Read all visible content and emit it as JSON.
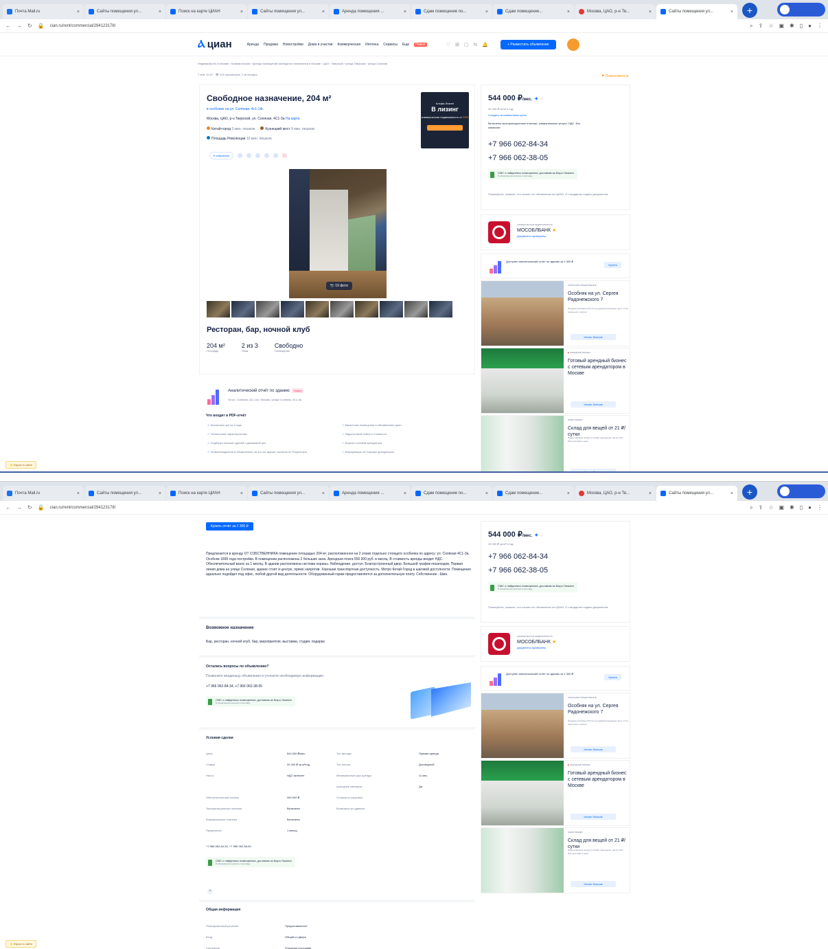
{
  "browser": {
    "tabs": [
      {
        "title": "Почта Mail.ru",
        "fav": "doc"
      },
      {
        "title": "Сайты помещения ул...",
        "fav": "cian"
      },
      {
        "title": "Поиск на карте ЦИАН",
        "fav": "cian"
      },
      {
        "title": "Сайты помещения ул...",
        "fav": "cian"
      },
      {
        "title": "Аренда помещения ...",
        "fav": "cian"
      },
      {
        "title": "Сдам помещение по...",
        "fav": "cian"
      },
      {
        "title": "Сдам помещение...",
        "fav": "cian"
      },
      {
        "title": "Москва, ЦАО, р-н Тв...",
        "fav": "red"
      },
      {
        "title": "Сайты помещения ул...",
        "fav": "cian",
        "active": true
      }
    ],
    "url": "cian.ru/rent/commercial/294123178/",
    "new_tab": "+"
  },
  "header": {
    "logo": "циан",
    "nav": [
      "Аренда",
      "Продажа",
      "Новостройки",
      "Дома и участки",
      "Коммерческая",
      "Ипотека",
      "Сервисы",
      "Еще"
    ],
    "nav_new": "Новое",
    "post_button": "+ Разместить объявление"
  },
  "breadcrumbs": "Недвижимость в Москве › Коммерческая › Аренда помещений свободного назначения в Москве › ЦАО › Тверской › улица Тверская › улица Cоляная",
  "meta": "7 янв, 12:57 · 👁 478 просмотров, 2 за сегодня",
  "complain": "⚑ Пожаловаться",
  "listing": {
    "title": "Свободное назначение, 204 м²",
    "building_link": "в особняке на ул. Соляная, 4с1-14с",
    "address": "Москва, ЦАО, р-н Тверской, ул. Соляная, 4С1-3а",
    "address_map": "На карте",
    "metro": [
      {
        "name": "Китай-город",
        "time": "3 мин. пешком",
        "color": "#f58220"
      },
      {
        "name": "Кузнецкий мост",
        "time": "9 мин. пешком",
        "color": "#8d5b2d"
      },
      {
        "name": "Площадь Революции",
        "time": "10 мин. пешком",
        "color": "#0078bf"
      }
    ],
    "actions_label": "В избранное",
    "photo_count_label": "📷 19 фото",
    "subtitle": "Ресторан, бар, ночной клуб",
    "facts": [
      {
        "value": "204 м²",
        "label": "Площадь"
      },
      {
        "value": "2 из 3",
        "label": "Этаж"
      },
      {
        "value": "Свободно",
        "label": "Помещение"
      }
    ]
  },
  "ad": {
    "brand": "Альфа-Лизинг",
    "big": "В лизинг",
    "small": "коммерческая недвижимость от",
    "highlight": "20%"
  },
  "report": {
    "title": "Аналитический отчёт по зданию",
    "new": "Новое",
    "address": "На ул. Соляная, 4с1-14с, Москва, улица Соляная, 4С1-3а",
    "heading": "Что входит в PDF-отчёт",
    "items_left": [
      "Аналитика цен за 3 года",
      "Технические характеристики",
      "Подборка похожих зданий с динамикой цен",
      "Правообладатели в объявлениях на это же здание: выписки из Росреестра"
    ],
    "items_right": [
      "Вакантные помещения в объявлениях Циан",
      "Кадастровый номер и стоимость",
      "Возраст сетевой арендатора",
      "Информация об текущих арендаторах"
    ],
    "button": "Купить отчёт за 2 300 ₽"
  },
  "sidebar": {
    "price": "544 000 ₽",
    "price_unit": "/мес.",
    "price_plus": "✦",
    "price_per_m": "32 000 ₽ за м² в год",
    "watch": "Следить за изменением цены",
    "tags": "Включены эксплуатационные платежи, коммунальные услуги, НДС. Без комиссии",
    "phone1": "+7 966 062-84-34",
    "phone2": "+7 966 062-38-05",
    "sms_title": "СМС о найденных помещениях, доставим за Бюро Лизинга",
    "sms_sub": "В обновлённом наличии в прохладу",
    "note": "Пожалуйста, скажите, что нашли это объявление на ЦИАН. О стандартах подачи документов",
    "bank_small": "КОММЕРЧЕСКАЯ НЕДВИЖИМОСТЬ",
    "bank_name": "МОСОБЛБАНК",
    "bank_docs": "Документы проверены",
    "mini_report": "Доступен аналитический отчёт по зданию за 2 300 ₽",
    "mini_button": "Купить"
  },
  "promos": [
    {
      "label": "КОМПАНИЯ-ПРЕДЛОЖЕНИЕ",
      "title": "Особняк на ул. Сергея Радонежского 7",
      "desc": "Продажа особняка 1479 м² под административные цели. 1.5 га земельного участка",
      "button": "Узнать больше",
      "kind": "building",
      "red": false
    },
    {
      "label": "АРЕНДНЫЙ БИЗНЕС",
      "title": "Готовый арендный бизнес с сетевым арендатором в Москве",
      "desc": "",
      "button": "Узнать больше",
      "kind": "shop",
      "red": true
    },
    {
      "label": "ЗАВОЗ ВРЕМЯ",
      "title": "Склад для вещей от 21 ₽/сутки",
      "desc": "Предоставляем склад в 2 ячейки помещения, доступ 24/7. Бокс доставка 1 день",
      "button": "Узнать больше",
      "kind": "warehouse",
      "red": false
    }
  ],
  "help_button": "⭐ Юрист в сайте",
  "page2": {
    "description": "Предлагается в аренду ОТ СОБСТВЕННИКА помещение площадью 204 м², расположенное на 2 этаже отдельно стоящего особняка по адресу: ул. Соляная 4С1-3а. Особняк 1895 года постройки. В помещении расположены 2 больших зала. Арендная плата 550 000 руб. в месяц. В стоимость аренды входит НДС. Обеспечительный взнос за 1 месяц. В здании расположена система охраны. Наблюдение, доступ. Благоустроенный двор. Большой трафик пешеходов. Первая линия дома на улице Соляная, здание стоит в центре, прямо напротив. Хорошая транспортная доступность. Метро Китай-Город в шаговой доступности. Помещение идеально подойдет под офис, любой другой вид деятельности. Оборудованный гараж предоставляется за дополнительную плату. Собственник - Шмо.",
    "purpose_h": "Возможное назначение",
    "purpose": "Бар, ресторан, ночной клуб, бар, мероприятия, выставки, студия, подарки",
    "questions_h": "Остались вопросы по объявлению?",
    "questions_t": "Позвоните владельцу объявления и уточните необходимую информацию",
    "phones": "+7 966 062-84-34, +7 966 062-38-05",
    "terms_h": "Условия сделки",
    "terms": [
      {
        "k": "Цена",
        "v": "544 000 ₽/мес.",
        "k2": "Тип аренды",
        "v2": "Прямая аренда"
      },
      {
        "k": "Ставка",
        "v": "32 000 ₽ за м²/год",
        "k2": "Тип налога",
        "v2": "Договорный"
      },
      {
        "k": "Налог",
        "v": "НДС включен",
        "k2": "Минимальный срок аренды",
        "v2": "11 мес."
      },
      {
        "k": "",
        "v": "",
        "k2": "Арендные каникулы",
        "v2": "Да"
      },
      {
        "k": "Обеспечительный платеж",
        "v": "300 000 ₽",
        "k2": "Стоимость парковки",
        "v2": ""
      },
      {
        "k": "Эксплуатационные платежи",
        "v": "Включены",
        "k2": "Возможна ли сдвижка",
        "v2": ""
      },
      {
        "k": "Коммунальные платежи",
        "v": "Включены",
        "k2": "",
        "v2": ""
      },
      {
        "k": "Предоплата",
        "v": "1 месяц",
        "k2": "",
        "v2": ""
      }
    ],
    "general_h": "Общая информация",
    "general": [
      {
        "k": "Планировочный решение",
        "v": "Предоставляется"
      },
      {
        "k": "Вход",
        "v": "Общий со двора"
      },
      {
        "k": "Состояние",
        "v": "Отличное состояние"
      }
    ],
    "plus": "+"
  }
}
